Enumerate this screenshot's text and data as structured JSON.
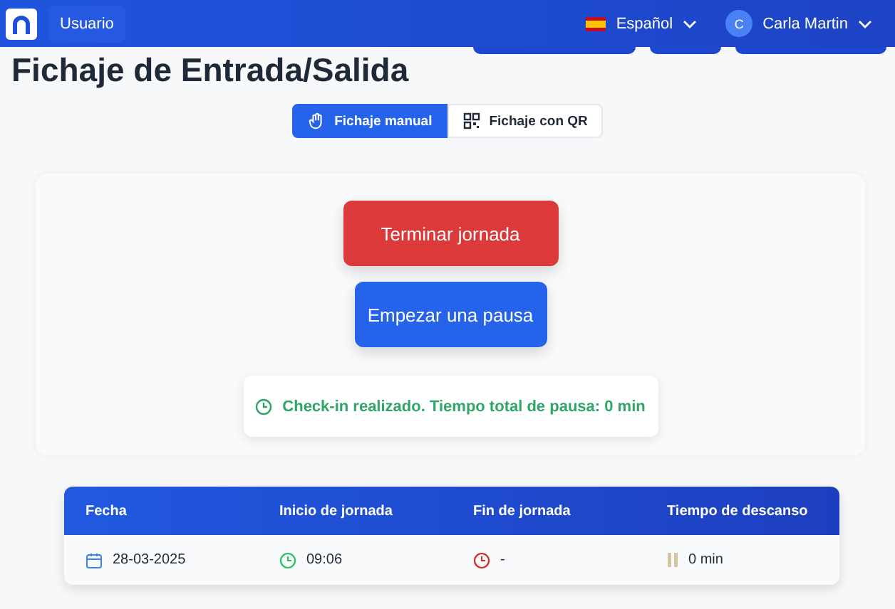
{
  "header": {
    "nav_item": "Usuario",
    "language": "Español",
    "user": {
      "initial": "C",
      "name": "Carla Martin"
    }
  },
  "page_title": "Fichaje de Entrada/Salida",
  "mode_tabs": [
    {
      "label": "Fichaje manual",
      "selected": true,
      "kind": "manual"
    },
    {
      "label": "Fichaje con QR",
      "selected": false,
      "kind": "qr"
    }
  ],
  "actions": [
    {
      "label": "Terminar jornada",
      "kind": "danger"
    },
    {
      "label": "Empezar una pausa",
      "kind": "primary"
    }
  ],
  "status": "Check-in realizado. Tiempo total de pausa: 0 min",
  "table": {
    "columns": [
      "Fecha",
      "Inicio de jornada",
      "Fin de jornada",
      "Tiempo de descanso"
    ],
    "rows": [
      [
        {
          "text": "28-03-2025",
          "kind": "date"
        },
        {
          "text": "09:06",
          "kind": "start"
        },
        {
          "text": "-",
          "kind": "end"
        },
        {
          "text": "0 min",
          "kind": "break"
        }
      ]
    ]
  }
}
